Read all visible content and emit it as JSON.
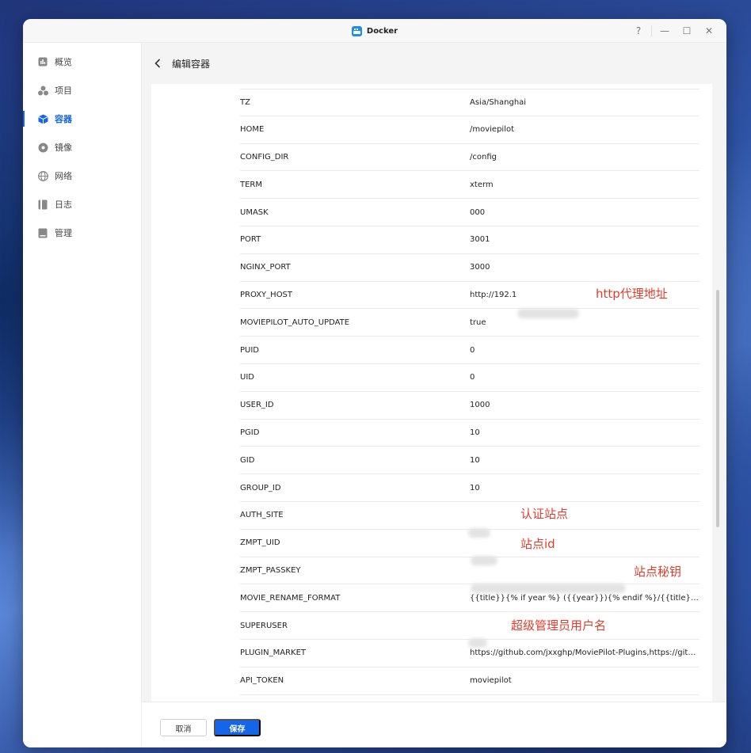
{
  "window": {
    "title": "Docker"
  },
  "titlebar": {
    "help": "?",
    "minimize": "—",
    "maximize": "☐",
    "close": "✕"
  },
  "sidebar": {
    "items": [
      {
        "label": "概览",
        "icon": "chart-icon",
        "active": false
      },
      {
        "label": "项目",
        "icon": "project-icon",
        "active": false
      },
      {
        "label": "容器",
        "icon": "container-icon",
        "active": true
      },
      {
        "label": "镜像",
        "icon": "image-icon",
        "active": false
      },
      {
        "label": "网络",
        "icon": "network-icon",
        "active": false
      },
      {
        "label": "日志",
        "icon": "log-icon",
        "active": false
      },
      {
        "label": "管理",
        "icon": "manage-icon",
        "active": false
      }
    ]
  },
  "header": {
    "title": "编辑容器"
  },
  "env": [
    {
      "key": "TZ",
      "value": "Asia/Shanghai"
    },
    {
      "key": "HOME",
      "value": "/moviepilot"
    },
    {
      "key": "CONFIG_DIR",
      "value": "/config"
    },
    {
      "key": "TERM",
      "value": "xterm"
    },
    {
      "key": "UMASK",
      "value": "000"
    },
    {
      "key": "PORT",
      "value": "3001"
    },
    {
      "key": "NGINX_PORT",
      "value": "3000"
    },
    {
      "key": "PROXY_HOST",
      "value": "http://192.1"
    },
    {
      "key": "MOVIEPILOT_AUTO_UPDATE",
      "value": "true"
    },
    {
      "key": "PUID",
      "value": "0"
    },
    {
      "key": "UID",
      "value": "0"
    },
    {
      "key": "USER_ID",
      "value": "1000"
    },
    {
      "key": "PGID",
      "value": "10"
    },
    {
      "key": "GID",
      "value": "10"
    },
    {
      "key": "GROUP_ID",
      "value": "10"
    },
    {
      "key": "AUTH_SITE",
      "value": ""
    },
    {
      "key": "ZMPT_UID",
      "value": ""
    },
    {
      "key": "ZMPT_PASSKEY",
      "value": ""
    },
    {
      "key": "MOVIE_RENAME_FORMAT",
      "value": "{{title}}{% if year %} ({{year}}){% endif %}/{{title}}{% if year %..."
    },
    {
      "key": "SUPERUSER",
      "value": ""
    },
    {
      "key": "PLUGIN_MARKET",
      "value": "https://github.com/jxxghp/MoviePilot-Plugins,https://github.c..."
    },
    {
      "key": "API_TOKEN",
      "value": "moviepilot"
    }
  ],
  "annotations": {
    "proxy": "http代理地址",
    "auth_site": "认证站点",
    "site_id": "站点id",
    "passkey": "站点秘钥",
    "superuser": "超级管理员用户名"
  },
  "footer": {
    "cancel": "取消",
    "save": "保存"
  },
  "colors": {
    "accent": "#1565e8",
    "annotation": "#e53b2c"
  }
}
